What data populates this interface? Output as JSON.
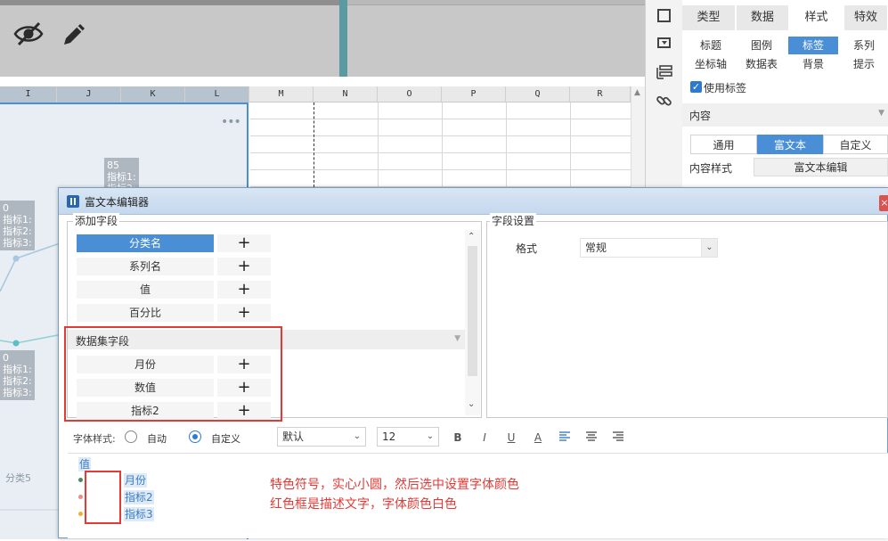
{
  "app": {
    "accent": "#4a8fd6"
  },
  "toolbar": {
    "hide_icon": "eye-slash-icon",
    "edit_icon": "pencil-icon"
  },
  "sheet": {
    "columns": [
      "I",
      "J",
      "K",
      "L",
      "M",
      "N",
      "O",
      "P",
      "Q",
      "R"
    ],
    "chart_menu": "•••",
    "tips": [
      {
        "value": "85",
        "lines": [
          "指标1:",
          "指标2:"
        ]
      },
      {
        "value": "0",
        "lines": [
          "指标1:",
          "指标2:",
          "指标3:"
        ]
      },
      {
        "value": "0",
        "lines": [
          "指标1:",
          "指标2:",
          "指标3:"
        ]
      }
    ],
    "category_label": "分类5"
  },
  "side_panel": {
    "main_tabs": [
      {
        "label": "类型",
        "active": false
      },
      {
        "label": "数据",
        "active": false
      },
      {
        "label": "样式",
        "active": true
      },
      {
        "label": "特效",
        "active": false
      }
    ],
    "sub_tabs_row1": [
      {
        "label": "标题",
        "active": false
      },
      {
        "label": "图例",
        "active": false
      },
      {
        "label": "标签",
        "active": true
      },
      {
        "label": "系列",
        "active": false
      }
    ],
    "sub_tabs_row2": [
      {
        "label": "坐标轴",
        "active": false
      },
      {
        "label": "数据表",
        "active": false
      },
      {
        "label": "背景",
        "active": false
      },
      {
        "label": "提示",
        "active": false
      }
    ],
    "use_label": "使用标签",
    "content_section": "内容",
    "content_modes": [
      {
        "label": "通用",
        "active": false
      },
      {
        "label": "富文本",
        "active": true
      },
      {
        "label": "自定义",
        "active": false
      }
    ],
    "content_style_label": "内容样式",
    "rich_text_edit_button": "富文本编辑"
  },
  "dialog": {
    "title": "富文本编辑器",
    "add_field_legend": "添加字段",
    "basic_fields": [
      {
        "label": "分类名",
        "selected": true
      },
      {
        "label": "系列名",
        "selected": false
      },
      {
        "label": "值",
        "selected": false
      },
      {
        "label": "百分比",
        "selected": false
      }
    ],
    "add_symbol": "+",
    "dataset_section": "数据集字段",
    "dataset_fields": [
      {
        "label": "月份"
      },
      {
        "label": "数值"
      },
      {
        "label": "指标2"
      }
    ],
    "field_settings_legend": "字段设置",
    "format_label": "格式",
    "format_value": "常规",
    "font_style_label": "字体样式:",
    "font_style_options": [
      {
        "label": "自动",
        "checked": false
      },
      {
        "label": "自定义",
        "checked": true
      }
    ],
    "font_family_value": "默认",
    "font_size_value": "12",
    "format_buttons": [
      "B",
      "I",
      "U",
      "A"
    ],
    "editor": {
      "header_tag": "值",
      "rows": [
        {
          "tag": "月份",
          "dot_color": "#4a8a5a"
        },
        {
          "tag": "指标2",
          "dot_color": "#f08a8a"
        },
        {
          "tag": "指标3",
          "dot_color": "#f0b030"
        }
      ]
    },
    "annotations": [
      "特色符号，实心小圆，然后选中设置字体颜色",
      "红色框是描述文字，字体颜色白色"
    ]
  }
}
